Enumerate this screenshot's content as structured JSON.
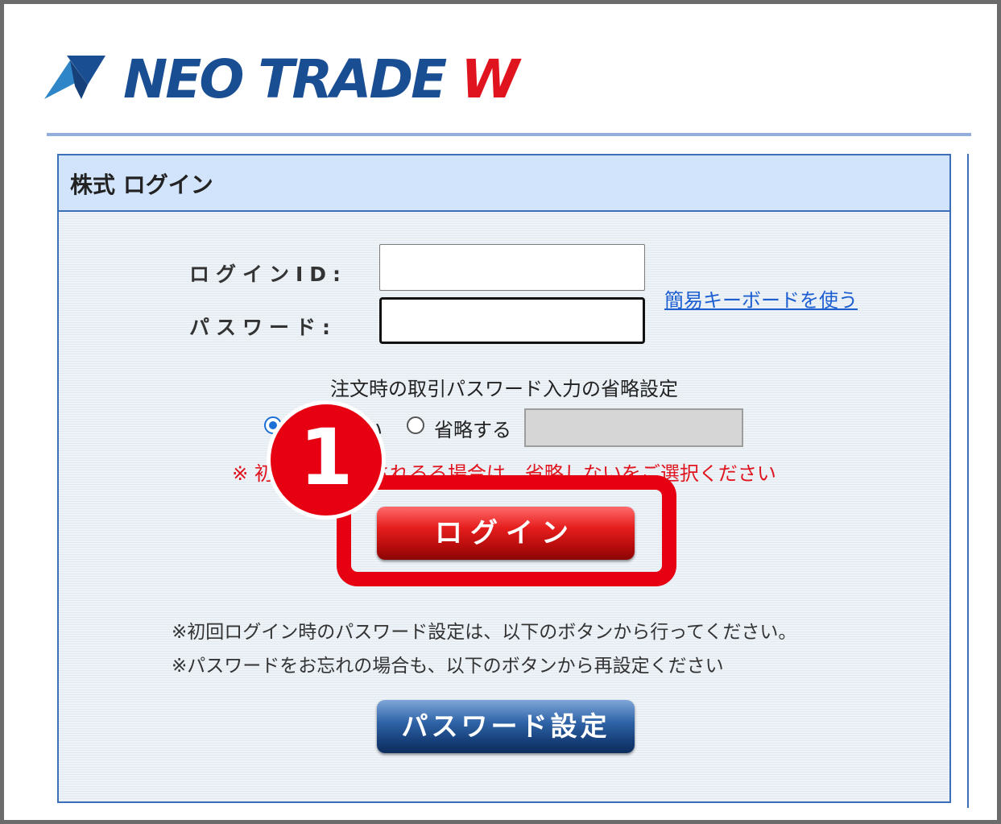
{
  "brand": {
    "logo_text": "NEO TRADE",
    "logo_suffix": "W",
    "colors": {
      "navy": "#1a4e93",
      "red": "#e0141e"
    }
  },
  "panel": {
    "title": "株式 ログイン"
  },
  "form": {
    "login_id_label": "ログインID:",
    "password_label": "パスワード:",
    "login_id_value": "",
    "password_value": "",
    "keyboard_link": "簡易キーボードを使う"
  },
  "omit_setting": {
    "title": "注文時の取引パスワード入力の省略設定",
    "option_no_omit": "い",
    "option_omit": "省略する",
    "selected": "no_omit",
    "warning": "※ 初　　　　　されるる場合は、省略しないをご選択ください"
  },
  "buttons": {
    "login": "ログイン",
    "password_setup": "パスワード設定"
  },
  "notes": {
    "line1": "※初回ログイン時のパスワード設定は、以下のボタンから行ってください。",
    "line2": "※パスワードをお忘れの場合も、以下のボタンから再設定ください"
  },
  "annotation": {
    "step_number": "1",
    "color": "#e60012"
  }
}
